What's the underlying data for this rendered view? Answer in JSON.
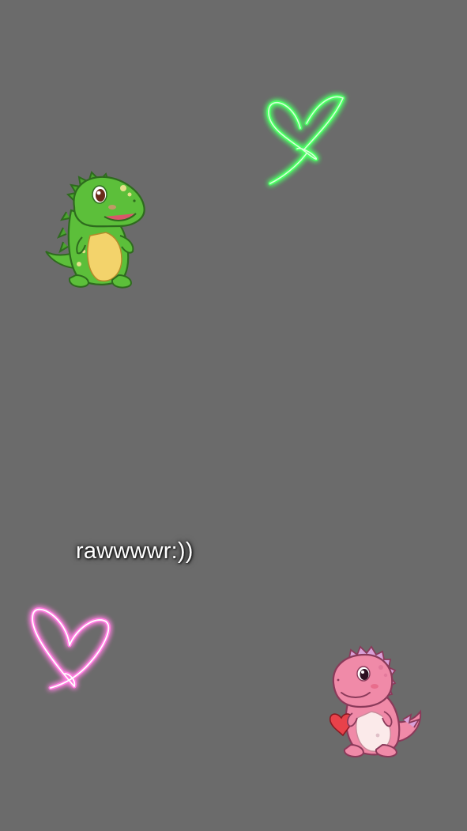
{
  "canvas": {
    "background": "#6b6b6b"
  },
  "caption": {
    "text": "rawwwwr:))",
    "color": "#ffffff"
  },
  "stickers": [
    {
      "name": "green-heart-icon",
      "color": "#39ff5a"
    },
    {
      "name": "pink-heart-icon",
      "color": "#ff7fe0"
    },
    {
      "name": "green-dinosaur-icon",
      "color": "#5cbf3a"
    },
    {
      "name": "pink-dinosaur-icon",
      "color": "#f08aa8"
    }
  ]
}
